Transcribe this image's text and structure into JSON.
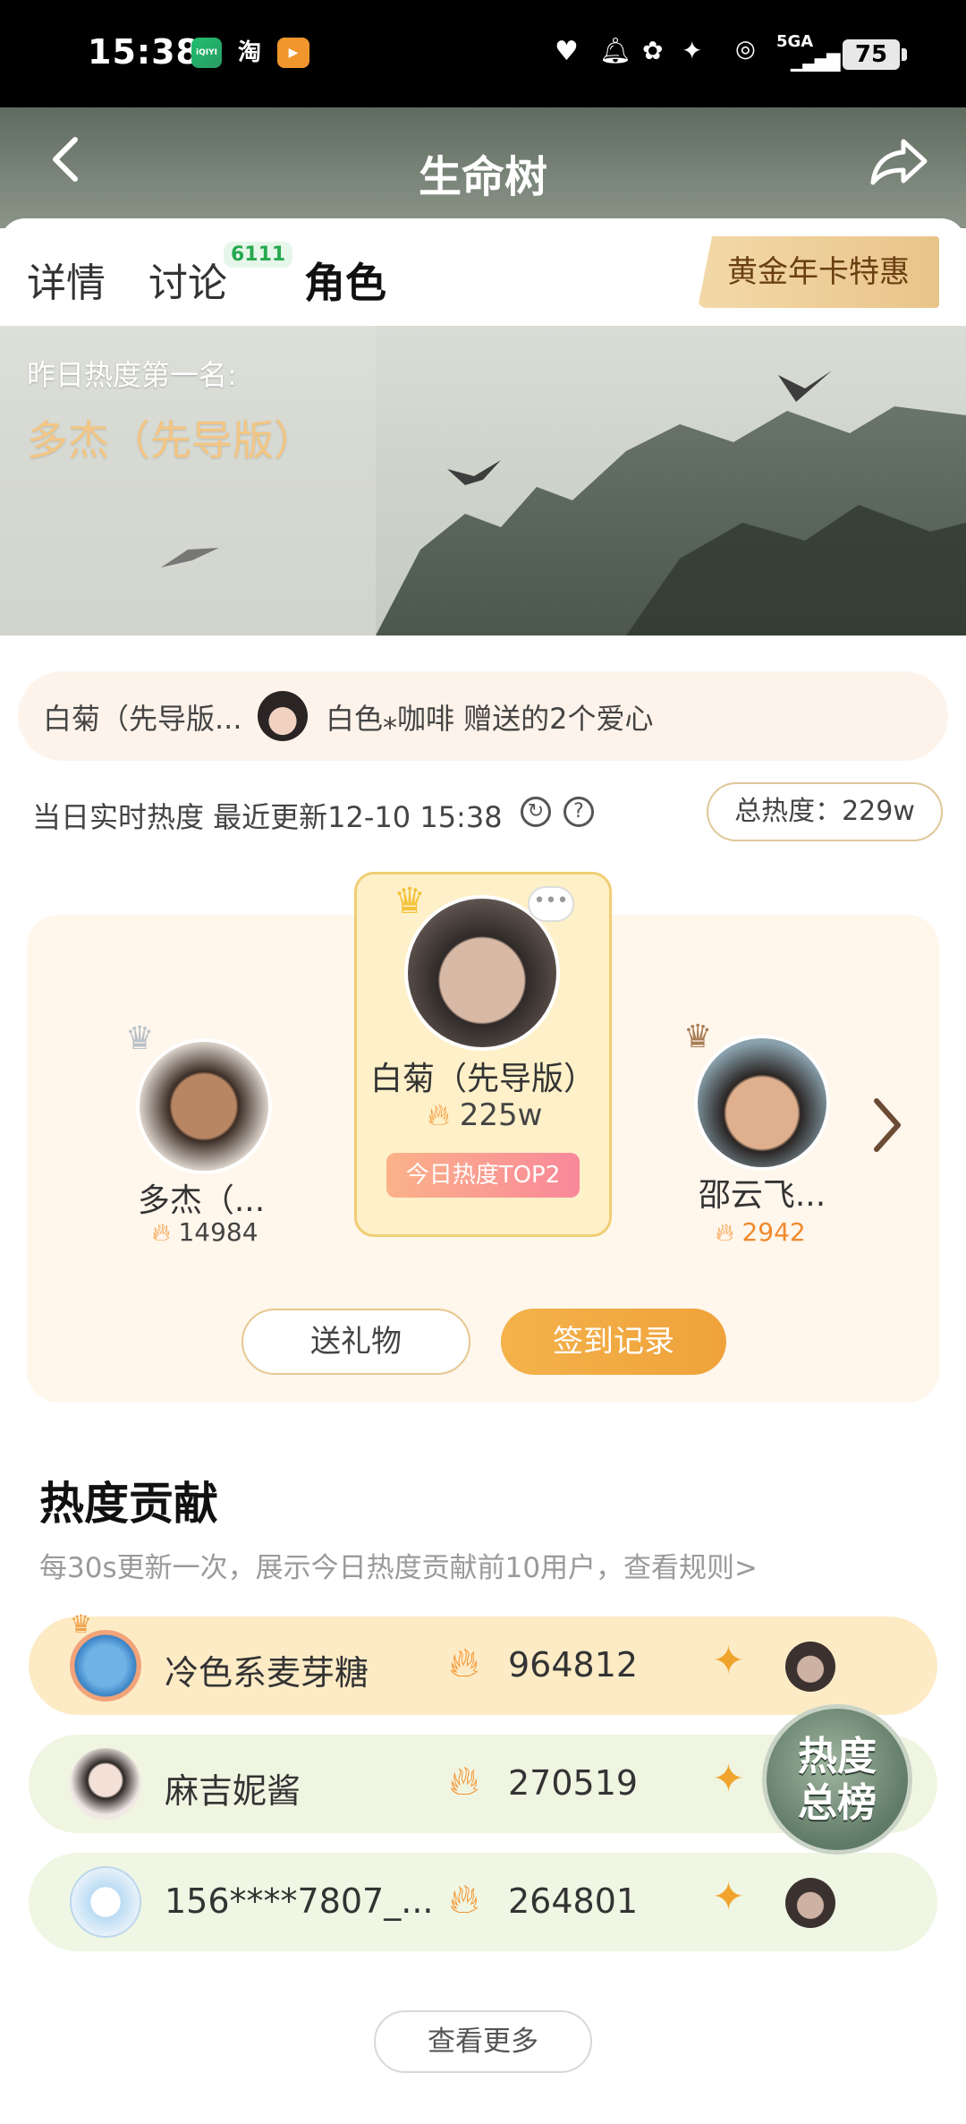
{
  "status_bar": {
    "time": "15:38",
    "apps": [
      "iQIYI",
      "淘"
    ],
    "network": "5GA",
    "battery": "75"
  },
  "header": {
    "title": "生命树",
    "back_icon": "chevron-left-icon",
    "share_icon": "share-arrow-icon"
  },
  "tabs": {
    "items": [
      {
        "label": "详情",
        "active": false
      },
      {
        "label": "讨论",
        "badge": "6111",
        "active": false
      },
      {
        "label": "角色",
        "active": true
      }
    ],
    "vip_button": "黄金年卡特惠"
  },
  "banner": {
    "subtitle": "昨日热度第一名:",
    "name": "多杰（先导版）"
  },
  "gift_notice": {
    "character": "白菊（先导版...",
    "message": "白色⁎咖啡 赠送的2个爱心"
  },
  "realtime": {
    "label": "当日实时热度 最近更新12-10 15:38",
    "refresh_icon": "refresh-icon",
    "help_icon": "help-icon",
    "total": "总热度：229w"
  },
  "ranking": {
    "first": {
      "name": "白菊（先导版）",
      "heat": "225w",
      "badge": "今日热度TOP2"
    },
    "second": {
      "name": "多杰（...",
      "heat": "14984"
    },
    "third": {
      "name": "邵云飞...",
      "heat": "2942"
    },
    "gift_button": "送礼物",
    "sign_button": "签到记录"
  },
  "contribution": {
    "title": "热度贡献",
    "description": "每30s更新一次，展示今日热度贡献前10用户，查看规则>",
    "rows": [
      {
        "name": "冷色系麦芽糖",
        "value": "964812"
      },
      {
        "name": "麻吉妮酱",
        "value": "270519"
      },
      {
        "name": "156****7807_...",
        "value": "264801"
      }
    ],
    "float_button": "热度\n总榜",
    "more_button": "查看更多"
  },
  "colors": {
    "accent_orange": "#f4b24b",
    "gold_text": "#f3c684",
    "row1_bg": "#fdebc6",
    "row2_bg": "#f0f5e2",
    "row3_bg": "#eff6e3"
  }
}
